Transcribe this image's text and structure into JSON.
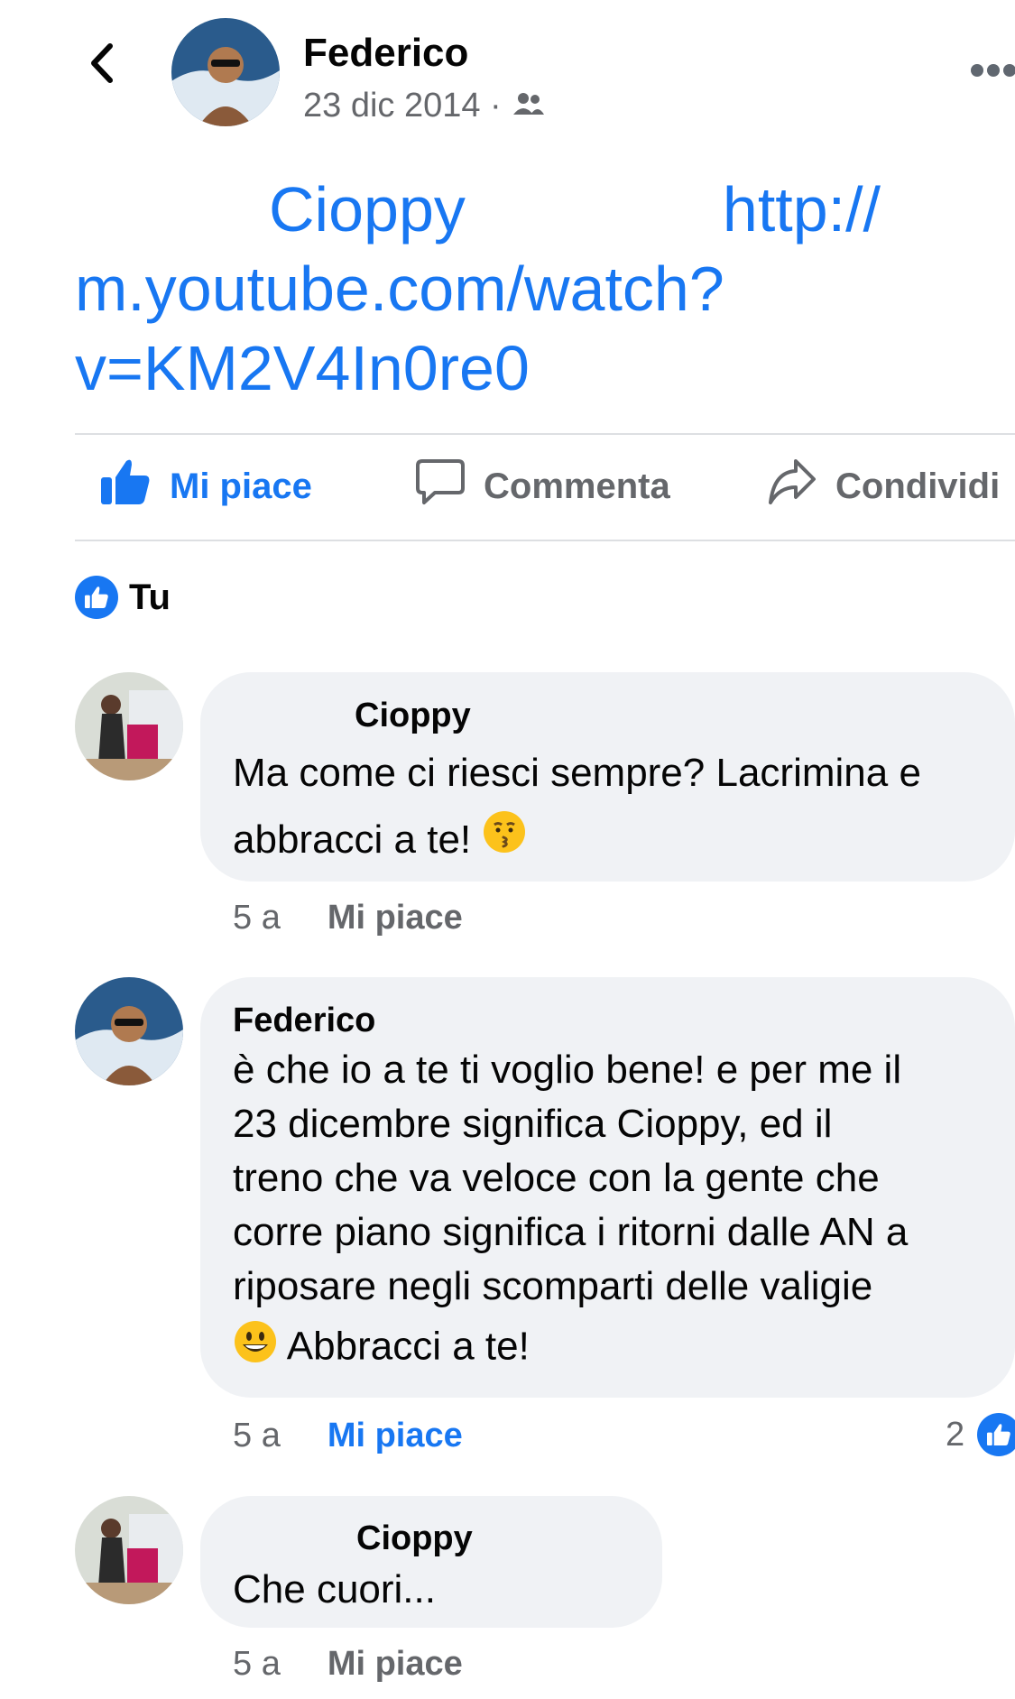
{
  "header": {
    "author": "Federico",
    "date": "23 dic 2014 ·",
    "audience_icon": "friends-icon"
  },
  "post": {
    "mention": "Cioppy",
    "url_part1": "http://",
    "url_part2": "m.youtube.com/watch?",
    "url_part3": "v=KM2V4In0re0"
  },
  "actions": {
    "like": "Mi piace",
    "comment": "Commenta",
    "share": "Condividi"
  },
  "reactions": {
    "who": "Tu"
  },
  "comments": [
    {
      "name": "Cioppy",
      "text_line1": "Ma come ci riesci sempre? Lacrimina e",
      "text_line2": "abbracci a te!",
      "emoji": "kissing-face",
      "time": "5 a",
      "like": "Mi piace"
    },
    {
      "name": "Federico",
      "text_lines": [
        "è che io a te ti voglio bene! e per me il",
        "23 dicembre significa Cioppy, ed il",
        "treno che va veloce con la gente che",
        "corre piano significa i ritorni dalle AN a",
        "riposare negli scomparti delle valigie"
      ],
      "text_last": "Abbracci a te!",
      "emoji": "grinning-face",
      "time": "5 a",
      "like": "Mi piace",
      "like_count": "2"
    },
    {
      "name": "Cioppy",
      "text": "Che cuori...",
      "time": "5 a",
      "like": "Mi piace"
    }
  ],
  "colors": {
    "accent": "#1877f2",
    "secondary_text": "#65676b",
    "bubble": "#f0f2f5",
    "divider": "#dddfe2"
  }
}
